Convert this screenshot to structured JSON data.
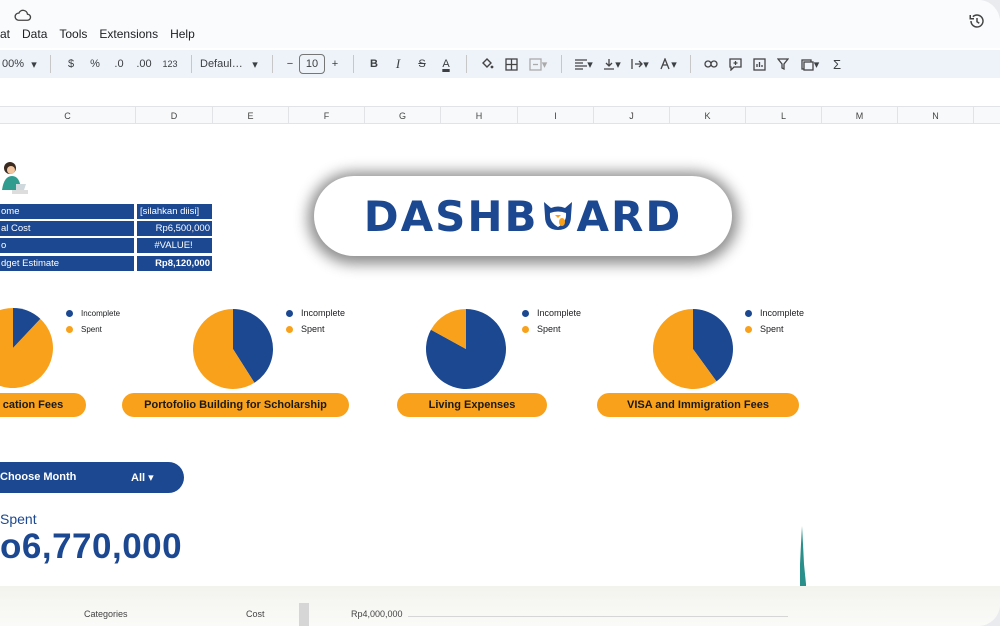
{
  "menu": [
    "at",
    "Data",
    "Tools",
    "Extensions",
    "Help"
  ],
  "toolbar": {
    "zoom": "00%",
    "currency": "$",
    "percent": "%",
    "dec_decrease": ".0",
    "dec_increase": ".00",
    "format_123": "123",
    "font": "Defaul…",
    "font_size": "10",
    "minus": "−",
    "plus": "+",
    "bold": "B",
    "italic": "I",
    "strike": "S",
    "text_color": "A",
    "sum": "Σ"
  },
  "columns": [
    "C",
    "D",
    "E",
    "F",
    "G",
    "H",
    "I",
    "J",
    "K",
    "L",
    "M",
    "N"
  ],
  "info_table": [
    {
      "label": "ome",
      "value": "[silahkan diisi]"
    },
    {
      "label": "al Cost",
      "value": "Rp6,500,000"
    },
    {
      "label": "o",
      "value": "#VALUE!"
    },
    {
      "label": "dget Estimate",
      "value": "Rp8,120,000"
    }
  ],
  "dashboard_title": {
    "before": "DASHB",
    "after": "ARD"
  },
  "colors": {
    "incomplete": "#1b4891",
    "spent": "#f9a11b",
    "brand": "#1b4891"
  },
  "charts": [
    {
      "label": "cation Fees",
      "incomplete_fraction": 0.12,
      "spent_fraction": 0.88
    },
    {
      "label": "Portofolio Building for Scholarship",
      "incomplete_fraction": 0.41,
      "spent_fraction": 0.59
    },
    {
      "label": "Living Expenses",
      "incomplete_fraction": 0.83,
      "spent_fraction": 0.17
    },
    {
      "label": "VISA and Immigration Fees",
      "incomplete_fraction": 0.4,
      "spent_fraction": 0.6
    }
  ],
  "legend": {
    "incomplete": "Incomplete",
    "spent": "Spent"
  },
  "month_filter": {
    "label": "Choose Month",
    "value": "All ▾"
  },
  "spent": {
    "label": "Spent",
    "value": "o6,770,000"
  },
  "bottom_table": {
    "categories": "Categories",
    "cost": "Cost",
    "axis_value": "Rp4,000,000"
  }
}
